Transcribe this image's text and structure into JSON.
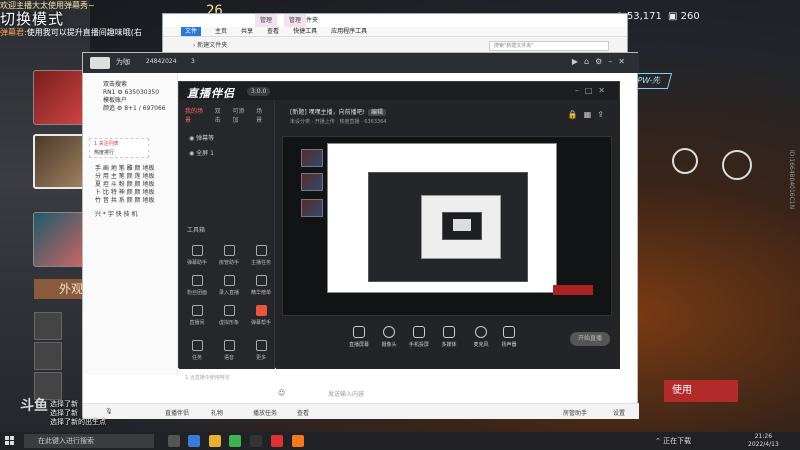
{
  "overlay": {
    "chat_line1": "欢迎主播大太使用弹幕秀~",
    "chat_line2": "切换模式",
    "chat_line3_user": "弹幕君:",
    "chat_line3_text": "使用我可以提升直播间趣味哦(右",
    "game_number": "26",
    "coins": "53,171",
    "gems": "260",
    "cpw_tag": "CPW-先",
    "use_button": "使用",
    "wai_tag": "外观",
    "side_caption": "ID:1664804016C1N",
    "bottom_chat": [
      "选择了新",
      "选择了新",
      "选择了新的出生点"
    ],
    "douyu_logo": "斗鱼"
  },
  "explorer": {
    "title": "新建文件夹",
    "tab_manage": "管理",
    "tab_manage2": "管理",
    "ribbon": [
      "文件",
      "主页",
      "共享",
      "查看",
      "快捷工具",
      "应用程序工具"
    ],
    "path": "› 新建文件夹",
    "search_placeholder": "搜索\"新建文件夹\""
  },
  "studio": {
    "username": "为咖",
    "room_id": "24842024",
    "fans": "3",
    "left_rows": [
      "双击搜索",
      "RN1 ⚙ 635030350",
      "模板账户",
      "颜追 ⚙ 8+1 / 697066"
    ],
    "menu_items": [
      "1 关注列表",
      "热度排行"
    ],
    "grid_rows": [
      "手 画 地 笔 雕 颜 地板",
      "分 用 主 笔 颜 莲 地板",
      "夏 坦 斗 粉 颜 颜 地板",
      "卜 比 特 神 颜 颜 地板",
      "竹 音 共 系 颜 颜 地板"
    ],
    "list_footer": "兴 * 宇 快 技 机",
    "input_placeholder": "发送输入内容",
    "footer_items": [
      "直播伴侣",
      "礼物",
      "播放任务",
      "查看"
    ],
    "footer_right": [
      "房管助手",
      "设置"
    ]
  },
  "companion": {
    "brand": "直播伴侣",
    "version": "3.0.0",
    "side_tabs": [
      "我的场景",
      "双击",
      "可添加",
      "场景"
    ],
    "scene_rows": [
      "弹幕等",
      "全屏 1"
    ],
    "tools_title": "工具箱",
    "tools": [
      "弹幕助手",
      "房管助手",
      "主播任务",
      "粉丝团面",
      "录入直播",
      "精华榜单",
      "直播间",
      "虚拟形象",
      "弹幕帮手",
      "任务",
      "语音",
      "更多"
    ],
    "hint": "1.当直播中使用特定",
    "live_title": "[新题] 嘿嘿主播，向前播吧!",
    "live_tag": "编辑",
    "live_info": "未设分类 · 开播上传 · 热度直播 · 6363364",
    "controls": [
      "直播屏幕",
      "摄像头",
      "手机投屏",
      "多媒体",
      "麦克风",
      "扬声器"
    ],
    "start_button": "开始直播"
  },
  "taskbar": {
    "search": "在此键入进行搜索",
    "tray_text": "正在下载",
    "time": "21:26",
    "date": "2022/4/13"
  },
  "colors": {
    "accent_red": "#b22a2a",
    "dark": "#232428",
    "douyu_orange": "#f3781e"
  }
}
